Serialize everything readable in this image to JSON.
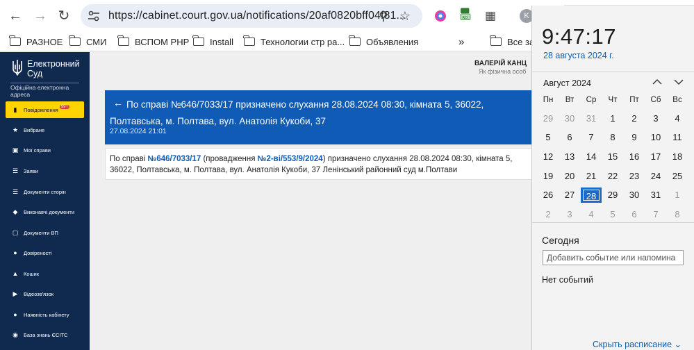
{
  "browser": {
    "url": "https://cabinet.court.gov.ua/notifications/20af0820bff04f81...",
    "profile_initial": "K",
    "bookmarks": [
      {
        "label": "РАЗНОЕ"
      },
      {
        "label": "СМИ"
      },
      {
        "label": "ВСПОМ РНР"
      },
      {
        "label": "Install"
      },
      {
        "label": "Технологии стр ра..."
      },
      {
        "label": "Объявления"
      },
      {
        "label": "Все за"
      }
    ],
    "more_bookmarks": "»"
  },
  "sidebar": {
    "logo_title_line1": "Електронний",
    "logo_title_line2": "Суд",
    "logo_subtitle": "Офіційна електронна адреса",
    "items": [
      {
        "label": "Повідомлення",
        "icon": "message-icon",
        "badge": "99+"
      },
      {
        "label": "Вибране",
        "icon": "star-icon"
      },
      {
        "label": "Мої справи",
        "icon": "folder-icon"
      },
      {
        "label": "Заяви",
        "icon": "list-icon"
      },
      {
        "label": "Документи сторін",
        "icon": "checklist-icon"
      },
      {
        "label": "Виконавчі документи",
        "icon": "layers-icon"
      },
      {
        "label": "Документи ВП",
        "icon": "document-icon"
      },
      {
        "label": "Довіреності",
        "icon": "users-icon"
      },
      {
        "label": "Кошик",
        "icon": "trash-icon"
      },
      {
        "label": "Відеозв'язок",
        "icon": "video-icon"
      },
      {
        "label": "Наявність кабінету",
        "icon": "person-icon"
      },
      {
        "label": "База знань ЄСІТС",
        "icon": "chat-icon"
      }
    ]
  },
  "user": {
    "name": "ВАЛЕРІЙ КАНЦ",
    "role": "Як фізична особ"
  },
  "notification": {
    "title": "По справі №646/7033/17 призначено слухання 28.08.2024 08:30, кімната 5, 36022, Полтавська, м. Полтава, вул. Анатолія Кукоби, 37",
    "date": "27.08.2024 21:01",
    "body_prefix": "По справі ",
    "case_number": "№646/7033/17",
    "body_mid": " (провадження ",
    "proceeding_number": "№2-ві/553/9/2024",
    "body_suffix": ") призначено слухання 28.08.2024 08:30, кімната 5, 36022, Полтавська, м. Полтава, вул. Анатолія Кукоби, 37 Ленінський районний суд м.Полтави"
  },
  "clock": {
    "time": "9:47:17",
    "date": "28 августа 2024 г.",
    "month": "Август 2024",
    "weekdays": [
      "Пн",
      "Вт",
      "Ср",
      "Чт",
      "Пт",
      "Сб",
      "Вс"
    ],
    "days": [
      [
        "29",
        "30",
        "31",
        "1",
        "2",
        "3",
        "4"
      ],
      [
        "5",
        "6",
        "7",
        "8",
        "9",
        "10",
        "11"
      ],
      [
        "12",
        "13",
        "14",
        "15",
        "16",
        "17",
        "18"
      ],
      [
        "19",
        "20",
        "21",
        "22",
        "23",
        "24",
        "25"
      ],
      [
        "26",
        "27",
        "28",
        "29",
        "30",
        "31",
        "1"
      ],
      [
        "2",
        "3",
        "4",
        "5",
        "6",
        "7",
        "8"
      ]
    ],
    "selected_day": "28",
    "today_label": "Сегодня",
    "event_placeholder": "Добавить событие или напомина",
    "no_events": "Нет событий",
    "hide_schedule": "Скрыть расписание"
  },
  "colors": {
    "sidebar_bg": "#0f2a4e",
    "active_item": "#ffd400",
    "header_blue": "#0f5bb5",
    "link_blue": "#0b5fb0",
    "today_blue": "#1b6ac9"
  }
}
